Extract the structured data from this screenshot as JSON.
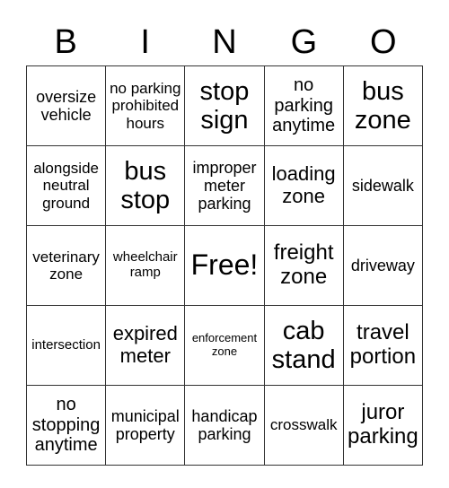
{
  "header": [
    "B",
    "I",
    "N",
    "G",
    "O"
  ],
  "rows": [
    [
      "oversize vehicle",
      "no parking prohibited hours",
      "stop sign",
      "no parking anytime",
      "bus zone"
    ],
    [
      "alongside neutral ground",
      "bus stop",
      "improper meter parking",
      "loading zone",
      "sidewalk"
    ],
    [
      "veterinary zone",
      "wheelchair ramp",
      "Free!",
      "freight zone",
      "driveway"
    ],
    [
      "intersection",
      "expired meter",
      "enforcement zone",
      "cab stand",
      "travel portion"
    ],
    [
      "no stopping anytime",
      "municipal property",
      "handicap parking",
      "crosswalk",
      "juror parking"
    ]
  ]
}
